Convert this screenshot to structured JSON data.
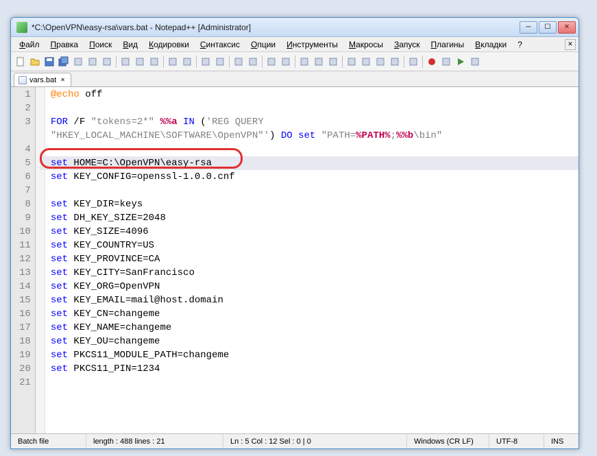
{
  "window": {
    "title": "*C:\\OpenVPN\\easy-rsa\\vars.bat - Notepad++ [Administrator]"
  },
  "menu": {
    "items": [
      "Файл",
      "Правка",
      "Поиск",
      "Вид",
      "Кодировки",
      "Синтаксис",
      "Опции",
      "Инструменты",
      "Макросы",
      "Запуск",
      "Плагины",
      "Вкладки",
      "?"
    ]
  },
  "tabs": {
    "active": "vars.bat"
  },
  "editor": {
    "lines": [
      {
        "n": 1,
        "segs": [
          {
            "t": "@echo",
            "c": "at"
          },
          {
            "t": " off"
          }
        ]
      },
      {
        "n": 2,
        "segs": []
      },
      {
        "n": 3,
        "segs": [
          {
            "t": "FOR",
            "c": "kw"
          },
          {
            "t": " /F "
          },
          {
            "t": "\"tokens=2*\"",
            "c": "str"
          },
          {
            "t": " "
          },
          {
            "t": "%%a",
            "c": "op"
          },
          {
            "t": " "
          },
          {
            "t": "IN",
            "c": "kw"
          },
          {
            "t": " ("
          },
          {
            "t": "'REG QUERY",
            "c": "q"
          }
        ]
      },
      {
        "n": "",
        "segs": [
          {
            "t": "\"HKEY_LOCAL_MACHINE\\SOFTWARE\\OpenVPN\"'",
            "c": "q"
          },
          {
            "t": ") "
          },
          {
            "t": "DO",
            "c": "kw"
          },
          {
            "t": " "
          },
          {
            "t": "set",
            "c": "kw"
          },
          {
            "t": " "
          },
          {
            "t": "\"PATH=",
            "c": "str"
          },
          {
            "t": "%PATH%",
            "c": "op"
          },
          {
            "t": ";",
            "c": "str"
          },
          {
            "t": "%%b",
            "c": "op"
          },
          {
            "t": "\\bin\"",
            "c": "str"
          }
        ]
      },
      {
        "n": 4,
        "segs": []
      },
      {
        "n": 5,
        "segs": [
          {
            "t": "set",
            "c": "kw"
          },
          {
            "t": " HOME=C:\\OpenVPN\\easy-rsa"
          }
        ],
        "hl": true
      },
      {
        "n": 6,
        "segs": [
          {
            "t": "set",
            "c": "kw"
          },
          {
            "t": " KEY_CONFIG=openssl-1.0.0.cnf"
          }
        ]
      },
      {
        "n": 7,
        "segs": []
      },
      {
        "n": 8,
        "segs": [
          {
            "t": "set",
            "c": "kw"
          },
          {
            "t": " KEY_DIR=keys"
          }
        ]
      },
      {
        "n": 9,
        "segs": [
          {
            "t": "set",
            "c": "kw"
          },
          {
            "t": " DH_KEY_SIZE=2048"
          }
        ]
      },
      {
        "n": 10,
        "segs": [
          {
            "t": "set",
            "c": "kw"
          },
          {
            "t": " KEY_SIZE=4096"
          }
        ]
      },
      {
        "n": 11,
        "segs": [
          {
            "t": "set",
            "c": "kw"
          },
          {
            "t": " KEY_COUNTRY=US"
          }
        ]
      },
      {
        "n": 12,
        "segs": [
          {
            "t": "set",
            "c": "kw"
          },
          {
            "t": " KEY_PROVINCE=CA"
          }
        ]
      },
      {
        "n": 13,
        "segs": [
          {
            "t": "set",
            "c": "kw"
          },
          {
            "t": " KEY_CITY=SanFrancisco"
          }
        ]
      },
      {
        "n": 14,
        "segs": [
          {
            "t": "set",
            "c": "kw"
          },
          {
            "t": " KEY_ORG=OpenVPN"
          }
        ]
      },
      {
        "n": 15,
        "segs": [
          {
            "t": "set",
            "c": "kw"
          },
          {
            "t": " KEY_EMAIL=mail@host.domain"
          }
        ]
      },
      {
        "n": 16,
        "segs": [
          {
            "t": "set",
            "c": "kw"
          },
          {
            "t": " KEY_CN=changeme"
          }
        ]
      },
      {
        "n": 17,
        "segs": [
          {
            "t": "set",
            "c": "kw"
          },
          {
            "t": " KEY_NAME=changeme"
          }
        ]
      },
      {
        "n": 18,
        "segs": [
          {
            "t": "set",
            "c": "kw"
          },
          {
            "t": " KEY_OU=changeme"
          }
        ]
      },
      {
        "n": 19,
        "segs": [
          {
            "t": "set",
            "c": "kw"
          },
          {
            "t": " PKCS11_MODULE_PATH=changeme"
          }
        ]
      },
      {
        "n": 20,
        "segs": [
          {
            "t": "set",
            "c": "kw"
          },
          {
            "t": " PKCS11_PIN=1234"
          }
        ]
      },
      {
        "n": 21,
        "segs": []
      }
    ]
  },
  "status": {
    "filetype": "Batch file",
    "length": "length : 488    lines : 21",
    "pos": "Ln : 5    Col : 12    Sel : 0 | 0",
    "eol": "Windows (CR LF)",
    "encoding": "UTF-8",
    "mode": "INS"
  },
  "toolbar_icons": [
    "new-file-icon",
    "open-file-icon",
    "save-icon",
    "save-all-icon",
    "close-icon",
    "close-all-icon",
    "print-icon",
    "sep",
    "cut-icon",
    "copy-icon",
    "paste-icon",
    "sep",
    "undo-icon",
    "redo-icon",
    "sep",
    "find-icon",
    "replace-icon",
    "sep",
    "zoom-in-icon",
    "zoom-out-icon",
    "sep",
    "sync-v-icon",
    "sync-h-icon",
    "sep",
    "wordwrap-icon",
    "show-all-chars-icon",
    "indent-guide-icon",
    "sep",
    "language-icon",
    "doc-map-icon",
    "function-list-icon",
    "folder-icon",
    "sep",
    "monitor-icon",
    "sep",
    "record-icon",
    "stop-icon",
    "play-icon",
    "play-multi-icon"
  ]
}
